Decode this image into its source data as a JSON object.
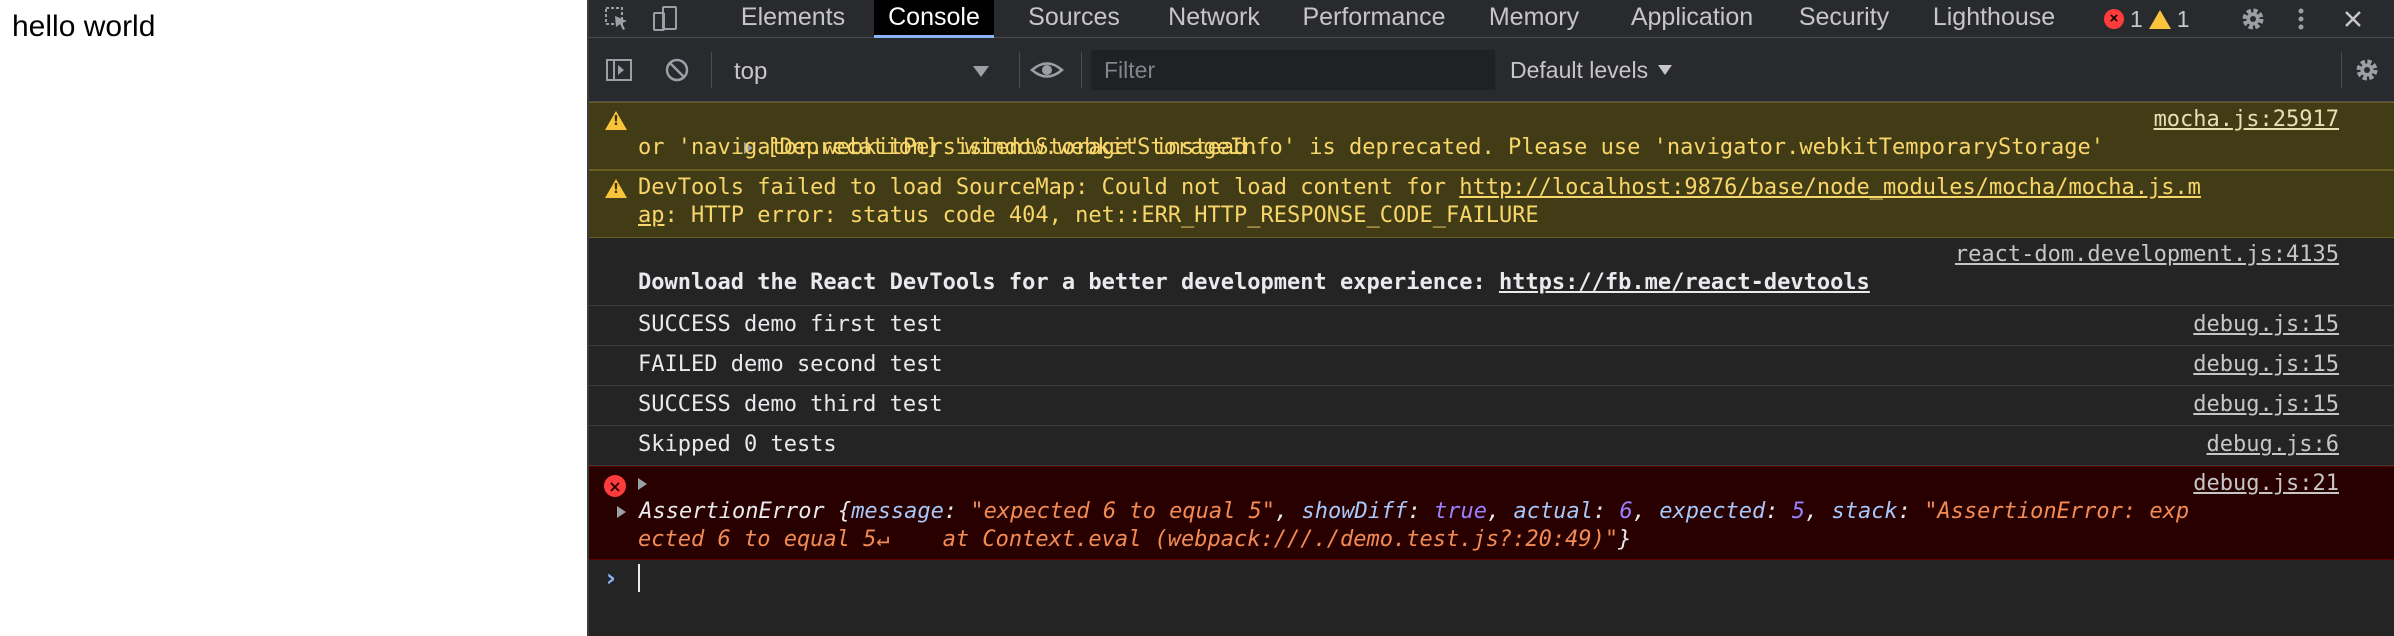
{
  "page": {
    "text": "hello world"
  },
  "devtools": {
    "tabs": [
      {
        "label": "Elements",
        "active": false
      },
      {
        "label": "Console",
        "active": true
      },
      {
        "label": "Sources",
        "active": false
      },
      {
        "label": "Network",
        "active": false
      },
      {
        "label": "Performance",
        "active": false
      },
      {
        "label": "Memory",
        "active": false
      },
      {
        "label": "Application",
        "active": false
      },
      {
        "label": "Security",
        "active": false
      },
      {
        "label": "Lighthouse",
        "active": false
      }
    ],
    "badges": {
      "errors": "1",
      "warnings": "1"
    },
    "icons": {
      "inspect": "inspect-element-icon",
      "device": "device-toolbar-icon",
      "settings": "gear-icon",
      "more": "more-vertical-icon",
      "close": "close-icon",
      "sidebar": "sidebar-toggle-icon",
      "clear": "clear-console-icon",
      "eye": "live-expression-eye-icon",
      "console_settings": "gear-icon"
    },
    "toolbar": {
      "context": "top",
      "filter_placeholder": "Filter",
      "levels": "Default levels"
    },
    "colors": {
      "background": "#242424",
      "warning_bg": "#413b16",
      "error_bg": "#290000",
      "accent": "#8ab4f8"
    }
  },
  "console": {
    "messages": [
      {
        "level": "warning",
        "line1": "[Deprecation] 'window.webkitStorageInfo' is deprecated. Please use 'navigator.webkitTemporaryStorage'",
        "line2": "or 'navigator.webkitPersistentStorage' instead.",
        "source": "mocha.js:25917"
      },
      {
        "level": "warning",
        "prefix": "DevTools failed to load SourceMap: Could not load content for ",
        "url_part1": "http://localhost:9876/base/node_modules/mocha/mocha.js.m",
        "url_part2": "ap",
        "suffix": ": HTTP error: status code 404, net::ERR_HTTP_RESPONSE_CODE_FAILURE"
      },
      {
        "level": "info",
        "source": "react-dom.development.js:4135",
        "text": "Download the React DevTools for a better development experience: ",
        "url": "https://fb.me/react-devtools"
      },
      {
        "level": "log",
        "text": "SUCCESS demo first test",
        "source": "debug.js:15"
      },
      {
        "level": "log",
        "text": "FAILED demo second test",
        "source": "debug.js:15"
      },
      {
        "level": "log",
        "text": "SUCCESS demo third test",
        "source": "debug.js:15"
      },
      {
        "level": "log",
        "text": "Skipped 0 tests",
        "source": "debug.js:6"
      },
      {
        "level": "error",
        "source": "debug.js:21",
        "object": {
          "name": "AssertionError",
          "open": " {",
          "k_message": "message",
          "v_message": "\"expected 6 to equal 5\"",
          "k_showDiff": "showDiff",
          "v_showDiff": "true",
          "k_actual": "actual",
          "v_actual": "6",
          "k_expected": "expected",
          "v_expected": "5",
          "k_stack": "stack",
          "v_stack_line1": "\"AssertionError: exp",
          "v_stack_line2": "ected 6 to equal 5↵    at Context.eval (webpack:///./demo.test.js?:20:49)\"",
          "close": "}"
        }
      }
    ],
    "prompt": "›"
  }
}
